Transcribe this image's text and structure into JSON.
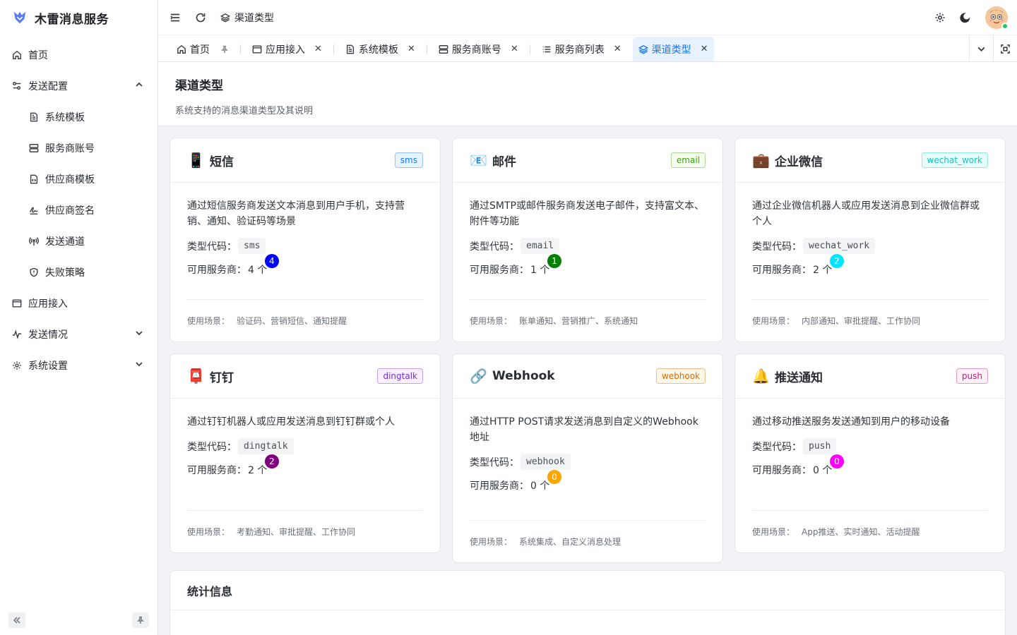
{
  "app": {
    "title": "木雷消息服务"
  },
  "sidebar": {
    "items": [
      {
        "label": "首页",
        "icon": "home-icon"
      },
      {
        "label": "发送配置",
        "icon": "settings-sliders-icon",
        "expanded": true
      },
      {
        "label": "系统模板",
        "icon": "file-text-icon"
      },
      {
        "label": "服务商账号",
        "icon": "server-icon"
      },
      {
        "label": "供应商模板",
        "icon": "file-code-icon"
      },
      {
        "label": "供应商签名",
        "icon": "signature-icon"
      },
      {
        "label": "发送通道",
        "icon": "broadcast-icon"
      },
      {
        "label": "失败策略",
        "icon": "shield-icon"
      },
      {
        "label": "应用接入",
        "icon": "window-icon"
      },
      {
        "label": "发送情况",
        "icon": "activity-icon"
      },
      {
        "label": "系统设置",
        "icon": "gear-icon"
      }
    ]
  },
  "header": {
    "breadcrumb": "渠道类型"
  },
  "tabs": [
    {
      "label": "首页"
    },
    {
      "label": "应用接入"
    },
    {
      "label": "系统模板"
    },
    {
      "label": "服务商账号"
    },
    {
      "label": "服务商列表"
    },
    {
      "label": "渠道类型",
      "active": true
    }
  ],
  "page": {
    "title": "渠道类型",
    "description": "系统支持的消息渠道类型及其说明"
  },
  "labels": {
    "type_code": "类型代码：",
    "providers": "可用服务商：",
    "scenarios": "使用场景：",
    "count_unit": "个"
  },
  "channels": [
    {
      "emoji": "📱",
      "name": "短信",
      "tag": "sms",
      "tag_color": "#1677ff",
      "description": "通过短信服务商发送文本消息到用户手机，支持营销、通知、验证码等场景",
      "code": "sms",
      "count": "4",
      "badge": "4",
      "badge_color": "#0000ff",
      "scenarios": "验证码、营销短信、通知提醒"
    },
    {
      "emoji": "📧",
      "name": "邮件",
      "tag": "email",
      "tag_color": "#389e0d",
      "description": "通过SMTP或邮件服务商发送电子邮件，支持富文本、附件等功能",
      "code": "email",
      "count": "1",
      "badge": "1",
      "badge_color": "#008000",
      "scenarios": "账单通知、营销推广、系统通知"
    },
    {
      "emoji": "💼",
      "name": "企业微信",
      "tag": "wechat_work",
      "tag_color": "#13c2c2",
      "description": "通过企业微信机器人或应用发送消息到企业微信群或个人",
      "code": "wechat_work",
      "count": "2",
      "badge": "2",
      "badge_color": "#00e5ff",
      "scenarios": "内部通知、审批提醒、工作协同"
    },
    {
      "emoji": "📮",
      "name": "钉钉",
      "tag": "dingtalk",
      "tag_color": "#722ed1",
      "description": "通过钉钉机器人或应用发送消息到钉钉群或个人",
      "code": "dingtalk",
      "count": "2",
      "badge": "2",
      "badge_color": "#800080",
      "scenarios": "考勤通知、审批提醒、工作协同"
    },
    {
      "emoji": "🔗",
      "name": "Webhook",
      "tag": "webhook",
      "tag_color": "#d46b08",
      "description": "通过HTTP POST请求发送消息到自定义的Webhook地址",
      "code": "webhook",
      "count": "0",
      "badge": "0",
      "badge_color": "#ffa500",
      "scenarios": "系统集成、自定义消息处理"
    },
    {
      "emoji": "🔔",
      "name": "推送通知",
      "tag": "push",
      "tag_color": "#c41d7f",
      "description": "通过移动推送服务发送通知到用户的移动设备",
      "code": "push",
      "count": "0",
      "badge": "0",
      "badge_color": "#ff00ff",
      "scenarios": "App推送、实时通知、活动提醒"
    }
  ],
  "stats": {
    "title": "统计信息"
  }
}
